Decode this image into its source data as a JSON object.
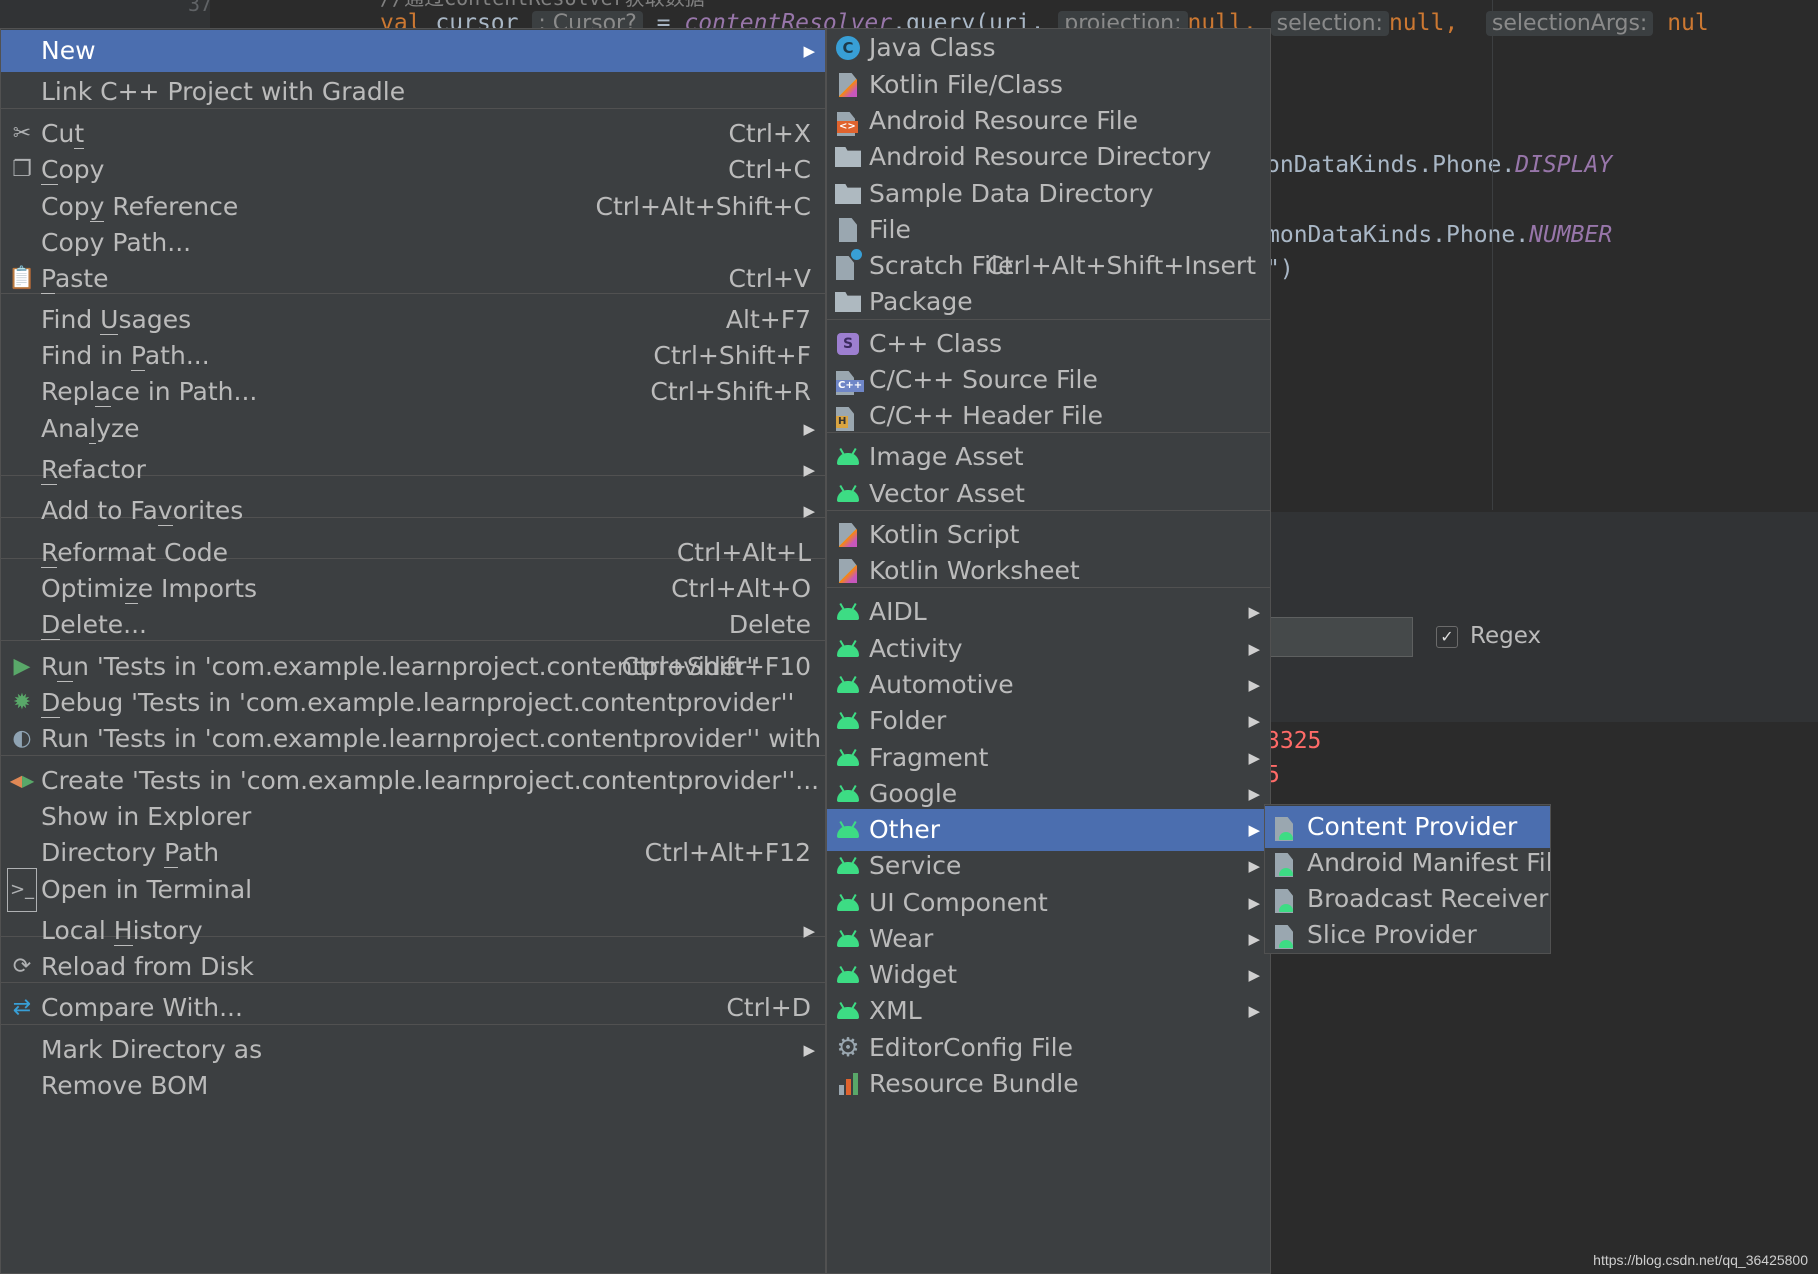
{
  "editor": {
    "line_number": "37",
    "comment": "//通过ContentResolver获取数据",
    "line1_val": "val",
    "line1_var": "cursor",
    "line1_hint": ": Cursor?",
    "line1_eq": "=",
    "line1_call": "contentResolver",
    "line1_method": ".query(uri,",
    "line1_hint2": "projection:",
    "line1_null1": "null,",
    "line1_hint3": "selection:",
    "line1_null2": "null,",
    "line1_hint4": "selectionArgs:",
    "line1_null3": "nul",
    "display_text": "onDataKinds.Phone.",
    "display_const": "DISPLAY",
    "number_text": "monDataKinds.Phone.",
    "number_const": "NUMBER",
    "paren_text": "\")",
    "regex_label": "Regex",
    "output1": "3325",
    "output2": "5",
    "watermark": "https://blog.csdn.net/qq_36425800"
  },
  "context_menu": {
    "items": [
      {
        "label": "New",
        "shortcut": "",
        "submenu": true,
        "selected": true,
        "icon": ""
      },
      {
        "label": "Link C++ Project with Gradle",
        "shortcut": "",
        "icon": ""
      },
      {
        "label": "Cut",
        "shortcut": "Ctrl+X",
        "icon": "scissors-icon"
      },
      {
        "label": "Copy",
        "shortcut": "Ctrl+C",
        "icon": "copy-icon"
      },
      {
        "label": "Copy Reference",
        "shortcut": "Ctrl+Alt+Shift+C",
        "icon": ""
      },
      {
        "label": "Copy Path...",
        "shortcut": "",
        "icon": ""
      },
      {
        "label": "Paste",
        "shortcut": "Ctrl+V",
        "icon": "clipboard-icon"
      },
      {
        "label": "Find Usages",
        "shortcut": "Alt+F7",
        "icon": ""
      },
      {
        "label": "Find in Path...",
        "shortcut": "Ctrl+Shift+F",
        "icon": ""
      },
      {
        "label": "Replace in Path...",
        "shortcut": "Ctrl+Shift+R",
        "icon": ""
      },
      {
        "label": "Analyze",
        "shortcut": "",
        "submenu": true,
        "icon": ""
      },
      {
        "label": "Refactor",
        "shortcut": "",
        "submenu": true,
        "icon": ""
      },
      {
        "label": "Add to Favorites",
        "shortcut": "",
        "submenu": true,
        "icon": ""
      },
      {
        "label": "Reformat Code",
        "shortcut": "Ctrl+Alt+L",
        "icon": ""
      },
      {
        "label": "Optimize Imports",
        "shortcut": "Ctrl+Alt+O",
        "icon": ""
      },
      {
        "label": "Delete...",
        "shortcut": "Delete",
        "icon": ""
      },
      {
        "label": "Run 'Tests in 'com.example.learnproject.contentprovider''",
        "shortcut": "Ctrl+Shift+F10",
        "icon": "run-icon"
      },
      {
        "label": "Debug 'Tests in 'com.example.learnproject.contentprovider''",
        "shortcut": "",
        "icon": "debug-icon"
      },
      {
        "label": "Run 'Tests in 'com.example.learnproject.contentprovider'' with Coverage",
        "shortcut": "",
        "icon": "coverage-icon"
      },
      {
        "label": "Create 'Tests in 'com.example.learnproject.contentprovider''...",
        "shortcut": "",
        "icon": "create-test-icon"
      },
      {
        "label": "Show in Explorer",
        "shortcut": "",
        "icon": ""
      },
      {
        "label": "Directory Path",
        "shortcut": "Ctrl+Alt+F12",
        "icon": ""
      },
      {
        "label": "Open in Terminal",
        "shortcut": "",
        "icon": "terminal-icon"
      },
      {
        "label": "Local History",
        "shortcut": "",
        "submenu": true,
        "icon": ""
      },
      {
        "label": "Reload from Disk",
        "shortcut": "",
        "icon": "reload-icon"
      },
      {
        "label": "Compare With...",
        "shortcut": "Ctrl+D",
        "icon": "compare-icon"
      },
      {
        "label": "Mark Directory as",
        "shortcut": "",
        "submenu": true,
        "icon": ""
      },
      {
        "label": "Remove BOM",
        "shortcut": "",
        "icon": ""
      }
    ]
  },
  "new_submenu": {
    "items": [
      {
        "label": "Java Class",
        "icon": "java-class-icon"
      },
      {
        "label": "Kotlin File/Class",
        "icon": "kotlin-file-icon"
      },
      {
        "label": "Android Resource File",
        "icon": "android-resource-file-icon"
      },
      {
        "label": "Android Resource Directory",
        "icon": "folder-icon"
      },
      {
        "label": "Sample Data Directory",
        "icon": "folder-icon"
      },
      {
        "label": "File",
        "icon": "file-icon"
      },
      {
        "label": "Scratch File",
        "shortcut": "Ctrl+Alt+Shift+Insert",
        "icon": "scratch-file-icon"
      },
      {
        "label": "Package",
        "icon": "package-icon"
      },
      {
        "label": "C++ Class",
        "icon": "cpp-class-icon"
      },
      {
        "label": "C/C++ Source File",
        "icon": "cpp-source-icon"
      },
      {
        "label": "C/C++ Header File",
        "icon": "cpp-header-icon"
      },
      {
        "label": "Image Asset",
        "icon": "android-icon"
      },
      {
        "label": "Vector Asset",
        "icon": "android-icon"
      },
      {
        "label": "Kotlin Script",
        "icon": "kotlin-script-icon"
      },
      {
        "label": "Kotlin Worksheet",
        "icon": "kotlin-worksheet-icon"
      },
      {
        "label": "AIDL",
        "icon": "android-icon",
        "submenu": true
      },
      {
        "label": "Activity",
        "icon": "android-icon",
        "submenu": true
      },
      {
        "label": "Automotive",
        "icon": "android-icon",
        "submenu": true
      },
      {
        "label": "Folder",
        "icon": "android-icon",
        "submenu": true
      },
      {
        "label": "Fragment",
        "icon": "android-icon",
        "submenu": true
      },
      {
        "label": "Google",
        "icon": "android-icon",
        "submenu": true
      },
      {
        "label": "Other",
        "icon": "android-icon",
        "submenu": true,
        "selected": true
      },
      {
        "label": "Service",
        "icon": "android-icon",
        "submenu": true
      },
      {
        "label": "UI Component",
        "icon": "android-icon",
        "submenu": true
      },
      {
        "label": "Wear",
        "icon": "android-icon",
        "submenu": true
      },
      {
        "label": "Widget",
        "icon": "android-icon",
        "submenu": true
      },
      {
        "label": "XML",
        "icon": "android-icon",
        "submenu": true
      },
      {
        "label": "EditorConfig File",
        "icon": "gear-icon"
      },
      {
        "label": "Resource Bundle",
        "icon": "resource-bundle-icon"
      }
    ]
  },
  "other_submenu": {
    "items": [
      {
        "label": "Content Provider",
        "icon": "android-file-icon",
        "selected": true
      },
      {
        "label": "Android Manifest File",
        "icon": "android-file-icon"
      },
      {
        "label": "Broadcast Receiver",
        "icon": "android-file-icon"
      },
      {
        "label": "Slice Provider",
        "icon": "android-file-icon"
      }
    ]
  },
  "colors": {
    "menu_bg": "#3c3f41",
    "selection": "#4b6eaf",
    "android_green": "#3ddc84",
    "editor_bg": "#2b2b2b"
  }
}
